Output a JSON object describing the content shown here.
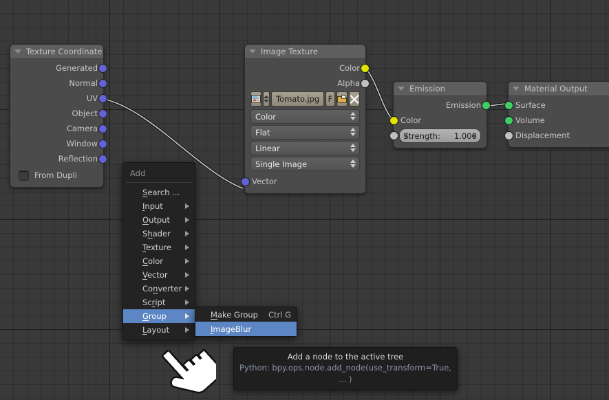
{
  "app": {
    "editor": "Blender Node Editor",
    "background_color": "#393939",
    "grid_color": "#2f2f2f"
  },
  "nodes": [
    {
      "id": "texture-coordinate",
      "title": "Texture Coordinate",
      "header_color": "#5e5e5e",
      "outputs": [
        {
          "label": "Generated",
          "socket": "vector",
          "color": "#6363d6"
        },
        {
          "label": "Normal",
          "socket": "vector",
          "color": "#6363d6"
        },
        {
          "label": "UV",
          "socket": "vector",
          "color": "#6363d6"
        },
        {
          "label": "Object",
          "socket": "vector",
          "color": "#6363d6"
        },
        {
          "label": "Camera",
          "socket": "vector",
          "color": "#6363d6"
        },
        {
          "label": "Window",
          "socket": "vector",
          "color": "#6363d6"
        },
        {
          "label": "Reflection",
          "socket": "vector",
          "color": "#6363d6"
        }
      ],
      "checkbox": {
        "label": "From Dupli",
        "checked": false
      }
    },
    {
      "id": "image-texture",
      "title": "Image Texture",
      "header_color": "#5e5e5e",
      "outputs": [
        {
          "label": "Color",
          "socket": "color",
          "color": "#e2e200"
        },
        {
          "label": "Alpha",
          "socket": "value",
          "color": "#c0c0c0"
        }
      ],
      "image_field": {
        "datablock_icon": "image-icon",
        "browse_icon": "browse-spinner-icon",
        "name": "Tomato.jpg",
        "fake_user_label": "F",
        "open_icon": "open-folder-icon",
        "unlink_icon": "unlink-x-icon"
      },
      "dropdowns": [
        {
          "name": "color-space",
          "value": "Color"
        },
        {
          "name": "projection",
          "value": "Flat"
        },
        {
          "name": "interpolation",
          "value": "Linear"
        },
        {
          "name": "source",
          "value": "Single Image"
        }
      ],
      "inputs": [
        {
          "label": "Vector",
          "socket": "vector",
          "color": "#6363d6"
        }
      ]
    },
    {
      "id": "emission",
      "title": "Emission",
      "header_color": "#5e5e5e",
      "outputs": [
        {
          "label": "Emission",
          "socket": "shader",
          "color": "#40cd62"
        }
      ],
      "inputs": [
        {
          "label": "Color",
          "socket": "color",
          "color": "#e2e200"
        }
      ],
      "value_slider": {
        "label": "Strength:",
        "value": "1.000",
        "socket": "value",
        "color": "#c0c0c0"
      }
    },
    {
      "id": "material-output",
      "title": "Material Output",
      "header_color": "#5e5e5e",
      "inputs": [
        {
          "label": "Surface",
          "socket": "shader",
          "color": "#40cd62"
        },
        {
          "label": "Volume",
          "socket": "shader",
          "color": "#40cd62"
        },
        {
          "label": "Displacement",
          "socket": "value",
          "color": "#c0c0c0"
        }
      ]
    }
  ],
  "add_menu": {
    "title": "Add",
    "items": [
      {
        "label": "Search ...",
        "accel": "S",
        "submenu": false
      },
      {
        "label": "Input",
        "accel": "I",
        "submenu": true
      },
      {
        "label": "Output",
        "accel": "O",
        "submenu": true
      },
      {
        "label": "Shader",
        "accel": "h",
        "submenu": true
      },
      {
        "label": "Texture",
        "accel": "T",
        "submenu": true
      },
      {
        "label": "Color",
        "accel": "C",
        "submenu": true
      },
      {
        "label": "Vector",
        "accel": "V",
        "submenu": true
      },
      {
        "label": "Converter",
        "accel": "n",
        "submenu": true
      },
      {
        "label": "Script",
        "accel": "r",
        "submenu": true
      },
      {
        "label": "Group",
        "accel": "G",
        "submenu": true,
        "selected": true
      },
      {
        "label": "Layout",
        "accel": "L",
        "submenu": true
      }
    ]
  },
  "group_submenu": {
    "items": [
      {
        "label": "Make Group",
        "accel": "M",
        "shortcut": "Ctrl G",
        "selected": false
      },
      {
        "label": "ImageBlur",
        "accel": "I",
        "shortcut": "",
        "selected": true
      }
    ]
  },
  "tooltip": {
    "title": "Add a node to the active tree",
    "python": "Python: bpy.ops.node.add_node(use_transform=True, ... )"
  },
  "cursor": {
    "icon": "pointing-hand-cursor"
  },
  "colors": {
    "menu_highlight": "#5d87c4",
    "node_body": "#4b4b4b",
    "node_header": "#5e5e5e",
    "menu_bg": "#232323",
    "tooltip_bg": "#1f1f1f",
    "link": "#c8c8c8"
  }
}
